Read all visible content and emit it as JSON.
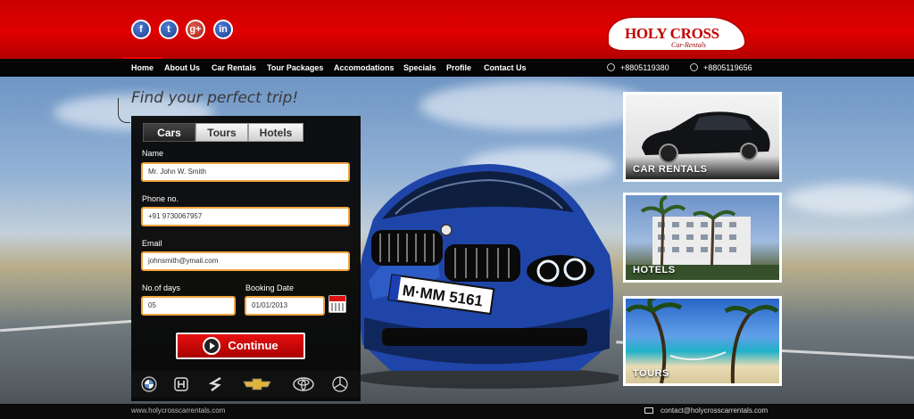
{
  "header": {
    "social": [
      {
        "icon": "facebook-icon",
        "glyph": "f"
      },
      {
        "icon": "twitter-icon",
        "glyph": "t"
      },
      {
        "icon": "google-plus-icon",
        "glyph": "g+"
      },
      {
        "icon": "linkedin-icon",
        "glyph": "in"
      }
    ],
    "logo": {
      "main": "HOLY CROSS",
      "sub": "Car-Rentals"
    }
  },
  "nav": {
    "items": [
      "Home",
      "About Us",
      "Car Rentals",
      "Tour Packages",
      "Accomodations",
      "Specials",
      "Profile",
      "Contact Us"
    ],
    "active": "Home",
    "phones": [
      "+8805119380",
      "+8805119656"
    ]
  },
  "hero": {
    "tagline": "Find your perfect trip!",
    "plate": "M·MM 5161"
  },
  "booking": {
    "tabs": [
      "Cars",
      "Tours",
      "Hotels"
    ],
    "active_tab": "Cars",
    "name_label": "Name",
    "name_value": "Mr. John W. Smith",
    "phone_label": "Phone no.",
    "phone_value": "+91 9730067957",
    "email_label": "Email",
    "email_value": "johnsmith@ymail.com",
    "days_label": "No.of days",
    "days_value": "05",
    "date_label": "Booking Date",
    "date_value": "01/01/2013",
    "continue_label": "Continue",
    "brands": [
      "bmw-logo-icon",
      "honda-logo-icon",
      "suzuki-logo-icon",
      "chevrolet-logo-icon",
      "toyota-logo-icon",
      "mercedes-logo-icon"
    ]
  },
  "cards": [
    {
      "label": "CAR RENTALS"
    },
    {
      "label": "HOTELS"
    },
    {
      "label": "TOURS"
    }
  ],
  "footer": {
    "website": "www.holycrosscarrentals.com",
    "email": "contact@holycrosscarrentals.com"
  },
  "colors": {
    "brand_red": "#d40000",
    "input_border": "#f0a640",
    "car_blue": "#1f45a8"
  }
}
